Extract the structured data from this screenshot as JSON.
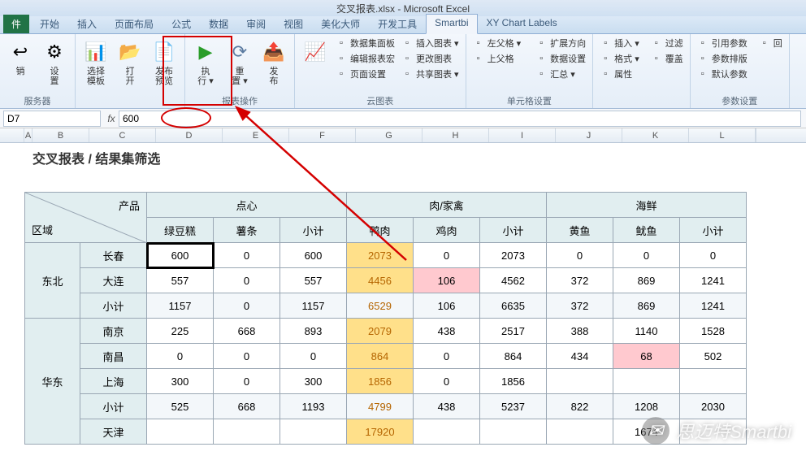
{
  "title": "交叉报表.xlsx - Microsoft Excel",
  "tabs": [
    "开始",
    "插入",
    "页面布局",
    "公式",
    "数据",
    "审阅",
    "视图",
    "美化大师",
    "开发工具",
    "Smartbi",
    "XY Chart Labels"
  ],
  "active_tab": "Smartbi",
  "file_tab": "件",
  "ribbon": {
    "g1": {
      "label": "服务器",
      "btns": [
        {
          "l1": "销",
          "l2": "",
          "ic": "↩"
        },
        {
          "l1": "设",
          "l2": "置",
          "ic": "⚙"
        }
      ]
    },
    "g2": {
      "label": "",
      "btns": [
        {
          "l1": "选择",
          "l2": "模板",
          "ic": "📊"
        },
        {
          "l1": "打",
          "l2": "开",
          "ic": "📂"
        },
        {
          "l1": "发布",
          "l2": "预览",
          "ic": "📄"
        }
      ]
    },
    "g3": {
      "label": "报表操作",
      "btns": [
        {
          "l1": "执",
          "l2": "行 ▾",
          "ic": "▶"
        },
        {
          "l1": "重",
          "l2": "置 ▾",
          "ic": "⟳"
        },
        {
          "l1": "发",
          "l2": "布",
          "ic": "📤"
        }
      ]
    },
    "g4": {
      "label": "云图表",
      "items": [
        "数据集面板",
        "编辑报表宏",
        "页面设置"
      ],
      "items2": [
        "插入图表 ▾",
        "更改图表",
        "共享图表 ▾"
      ]
    },
    "g5": {
      "label": "单元格设置",
      "items": [
        "左父格 ▾",
        "上父格"
      ],
      "items2": [
        "扩展方向",
        "数据设置",
        "汇总 ▾"
      ]
    },
    "g6": {
      "label": "",
      "items": [
        "插入 ▾",
        "格式 ▾",
        "属性"
      ],
      "items2": [
        "过滤",
        "覆盖",
        ""
      ]
    },
    "g7": {
      "label": "参数设置",
      "items": [
        "引用参数",
        "参数排版",
        "默认参数"
      ],
      "items2": [
        "回",
        ""
      ]
    }
  },
  "namebox": "D7",
  "fxvalue": "600",
  "colheads": [
    "A",
    "B",
    "C",
    "D",
    "E",
    "F",
    "G",
    "H",
    "I",
    "J",
    "K",
    "L"
  ],
  "sheet_title": "交叉报表  /  结果集筛选",
  "corner": {
    "top": "产品",
    "bottom": "区域"
  },
  "cat_headers": [
    "点心",
    "肉/家禽",
    "海鲜"
  ],
  "sub_headers": [
    [
      "绿豆糕",
      "薯条",
      "小计"
    ],
    [
      "鸭肉",
      "鸡肉",
      "小计"
    ],
    [
      "黄鱼",
      "鱿鱼",
      "小计"
    ]
  ],
  "regions": [
    {
      "name": "东北",
      "rows": [
        {
          "city": "长春",
          "v": [
            "600",
            "0",
            "600",
            "2073",
            "0",
            "2073",
            "0",
            "0",
            "0"
          ]
        },
        {
          "city": "大连",
          "v": [
            "557",
            "0",
            "557",
            "4456",
            "106",
            "4562",
            "372",
            "869",
            "1241"
          ]
        },
        {
          "city": "小计",
          "v": [
            "1157",
            "0",
            "1157",
            "6529",
            "106",
            "6635",
            "372",
            "869",
            "1241"
          ]
        }
      ]
    },
    {
      "name": "华东",
      "rows": [
        {
          "city": "南京",
          "v": [
            "225",
            "668",
            "893",
            "2079",
            "438",
            "2517",
            "388",
            "1140",
            "1528"
          ]
        },
        {
          "city": "南昌",
          "v": [
            "0",
            "0",
            "0",
            "864",
            "0",
            "864",
            "434",
            "68",
            "502"
          ]
        },
        {
          "city": "上海",
          "v": [
            "300",
            "0",
            "300",
            "1856",
            "0",
            "1856",
            "",
            "",
            ""
          ]
        },
        {
          "city": "小计",
          "v": [
            "525",
            "668",
            "1193",
            "4799",
            "438",
            "5237",
            "822",
            "1208",
            "2030"
          ]
        },
        {
          "city": "天津",
          "v": [
            "",
            "",
            "",
            "17920",
            "",
            "",
            "",
            "1674",
            ""
          ]
        }
      ]
    }
  ],
  "watermark": "思迈特Smartbi",
  "chart_data": {
    "type": "table",
    "title": "交叉报表 / 结果集筛选",
    "columns": [
      "区域",
      "城市",
      "点心-绿豆糕",
      "点心-薯条",
      "点心-小计",
      "肉/家禽-鸭肉",
      "肉/家禽-鸡肉",
      "肉/家禽-小计",
      "海鲜-黄鱼",
      "海鲜-鱿鱼",
      "海鲜-小计"
    ],
    "rows": [
      [
        "东北",
        "长春",
        600,
        0,
        600,
        2073,
        0,
        2073,
        0,
        0,
        0
      ],
      [
        "东北",
        "大连",
        557,
        0,
        557,
        4456,
        106,
        4562,
        372,
        869,
        1241
      ],
      [
        "东北",
        "小计",
        1157,
        0,
        1157,
        6529,
        106,
        6635,
        372,
        869,
        1241
      ],
      [
        "华东",
        "南京",
        225,
        668,
        893,
        2079,
        438,
        2517,
        388,
        1140,
        1528
      ],
      [
        "华东",
        "南昌",
        0,
        0,
        0,
        864,
        0,
        864,
        434,
        68,
        502
      ],
      [
        "华东",
        "上海",
        300,
        0,
        300,
        1856,
        0,
        1856,
        null,
        null,
        null
      ],
      [
        "华东",
        "小计",
        525,
        668,
        1193,
        4799,
        438,
        5237,
        822,
        1208,
        2030
      ],
      [
        "华东",
        "天津",
        null,
        null,
        null,
        17920,
        null,
        null,
        null,
        1674,
        null
      ]
    ]
  }
}
